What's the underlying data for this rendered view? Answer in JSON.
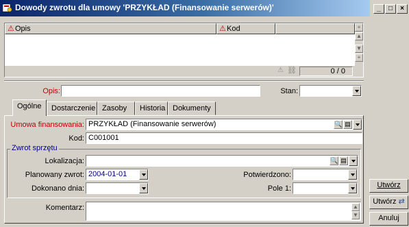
{
  "window": {
    "title": "Dowody zwrotu dla umowy 'PRZYKŁAD (Finansowanie serwerów)'"
  },
  "list": {
    "col_opis": "Opis",
    "col_kod": "Kod",
    "count": "0 / 0"
  },
  "form": {
    "opis_label": "Opis:",
    "opis_value": "",
    "stan_label": "Stan:",
    "stan_value": ""
  },
  "tabs": [
    "Ogólne",
    "Dostarczenie",
    "Zasoby",
    "Historia",
    "Dokumenty"
  ],
  "general": {
    "umowa_label": "Umowa finansowania:",
    "umowa_value": "PRZYKŁAD (Finansowanie serwerów)",
    "kod_label": "Kod:",
    "kod_value": "C001001",
    "group_title": "Zwrot sprzętu",
    "lokalizacja_label": "Lokalizacja:",
    "lokalizacja_value": "",
    "planowany_label": "Planowany zwrot:",
    "planowany_value": "2004-01-01",
    "potwierdzono_label": "Potwierdzono:",
    "potwierdzono_value": "",
    "dokonano_label": "Dokonano dnia:",
    "dokonano_value": "",
    "pole1_label": "Pole 1:",
    "pole1_value": "",
    "komentarz_label": "Komentarz:",
    "komentarz_value": ""
  },
  "buttons": {
    "create": "Utwórz",
    "create_link": "Utwórz",
    "cancel": "Anuluj"
  }
}
